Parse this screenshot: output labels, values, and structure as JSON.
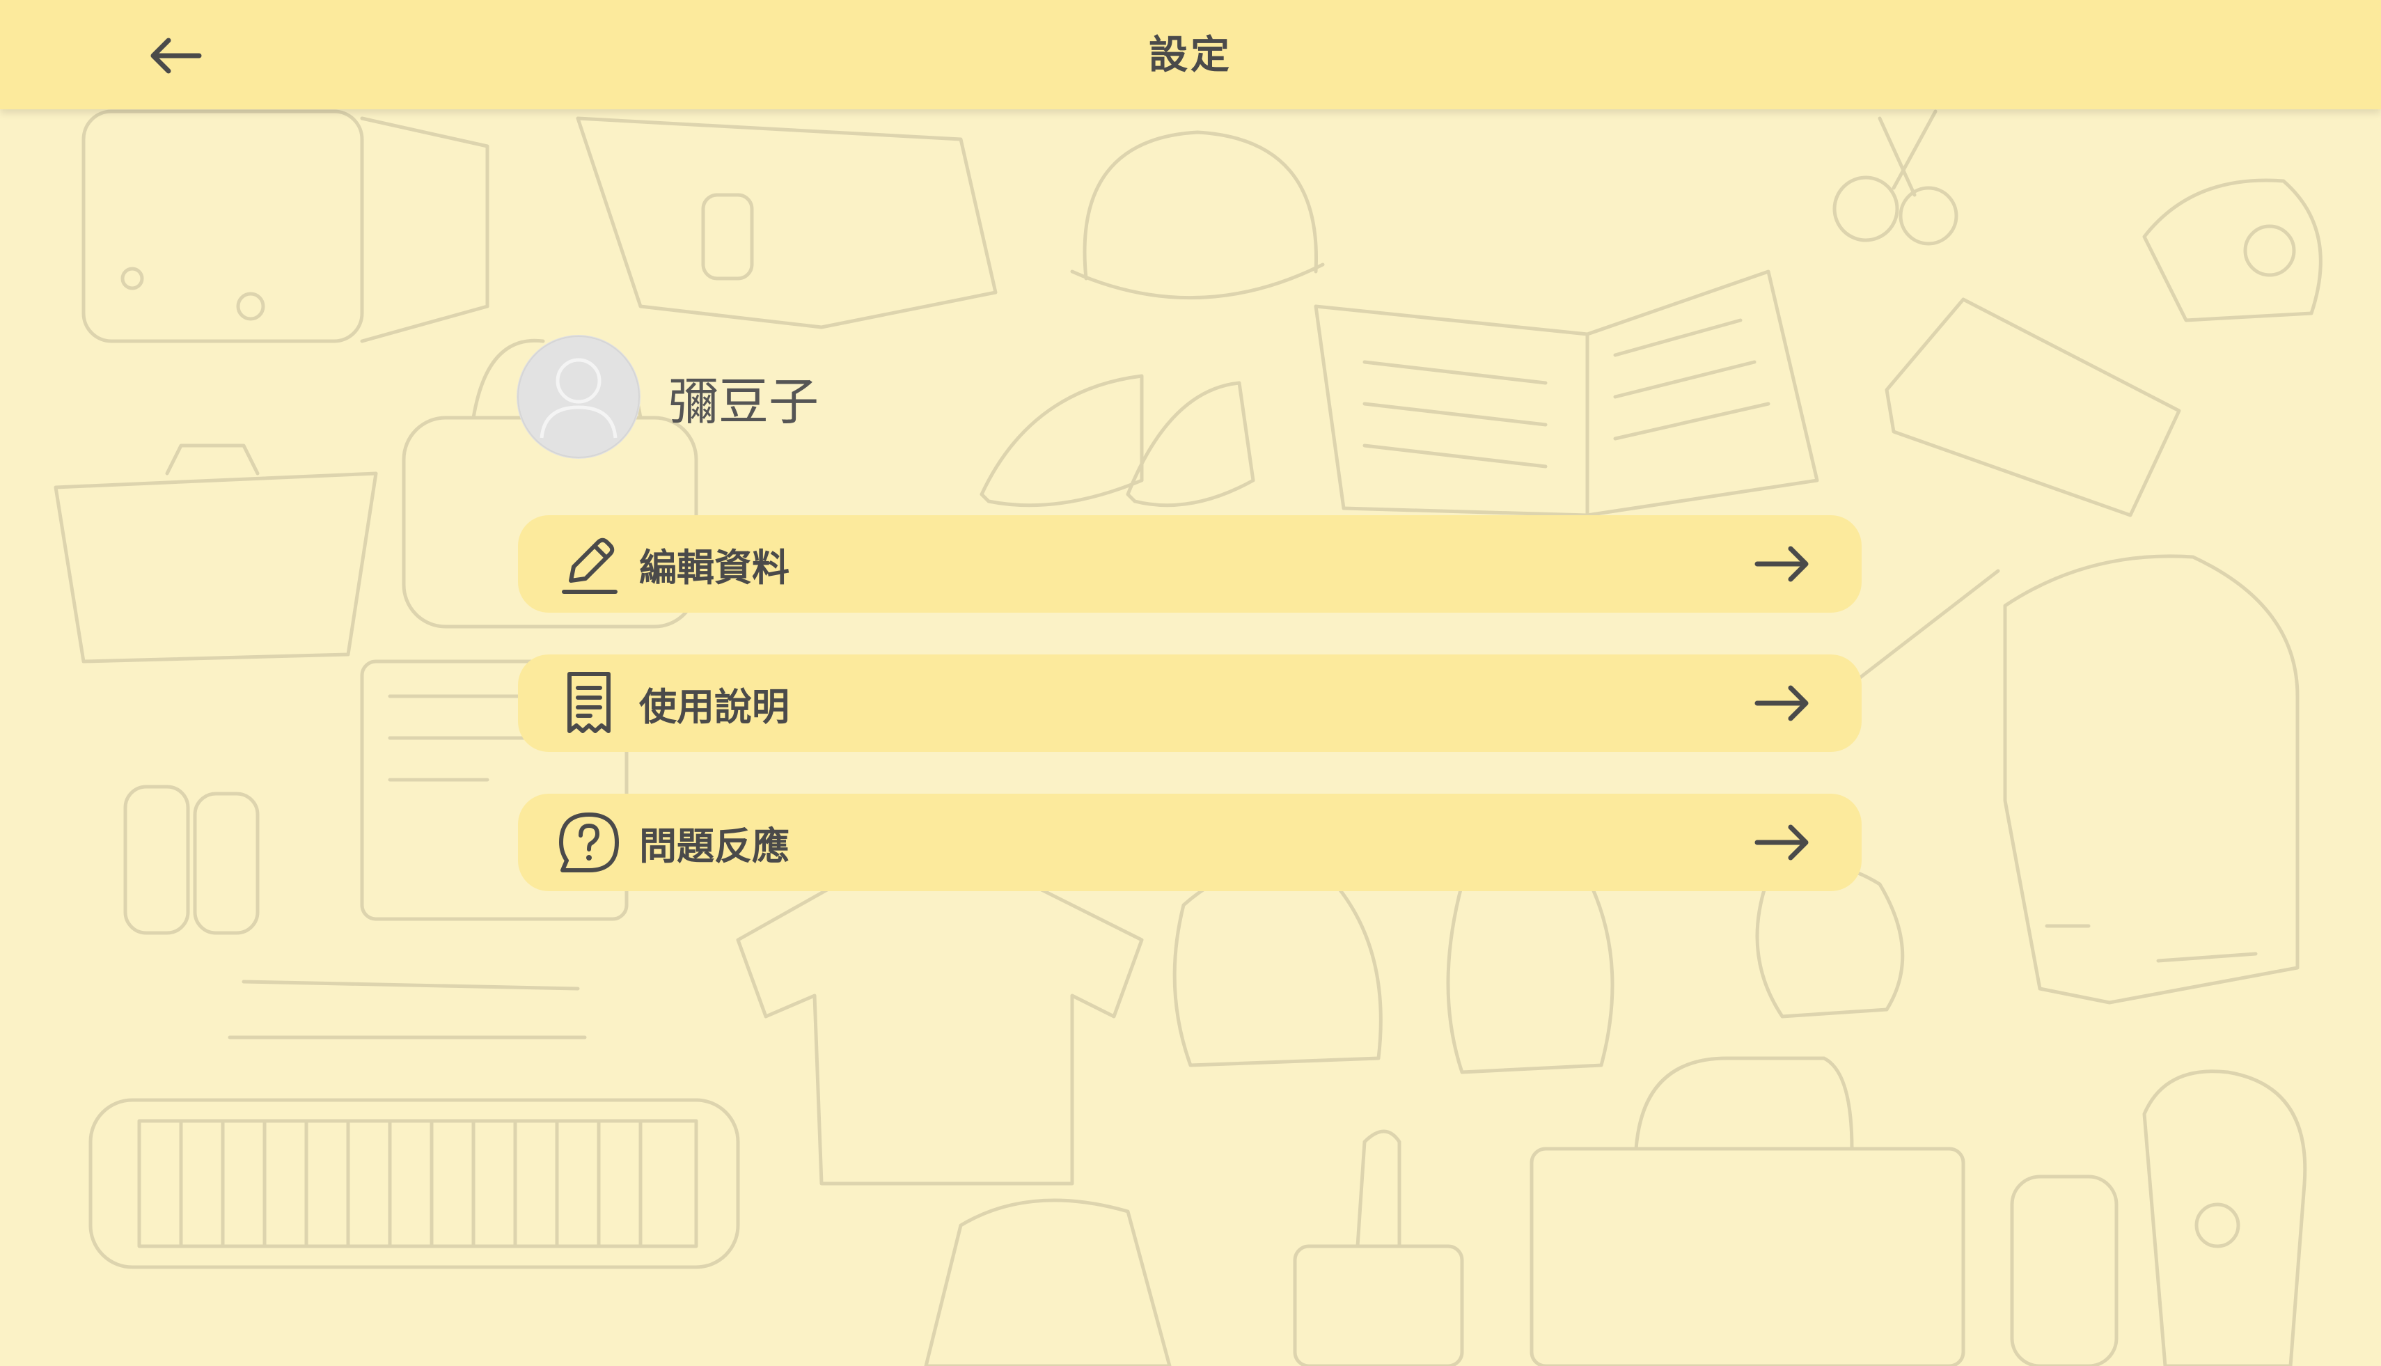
{
  "header": {
    "title": "設定",
    "back_icon": "arrow-left-icon"
  },
  "profile": {
    "name": "彌豆子",
    "avatar_icon": "user-avatar-icon"
  },
  "menu": [
    {
      "label": "編輯資料",
      "icon": "pencil-icon",
      "trailing_icon": "arrow-right-icon"
    },
    {
      "label": "使用說明",
      "icon": "receipt-document-icon",
      "trailing_icon": "arrow-right-icon"
    },
    {
      "label": "問題反應",
      "icon": "question-bubble-icon",
      "trailing_icon": "arrow-right-icon"
    }
  ],
  "colors": {
    "header_bg": "#FCEA9C",
    "page_bg": "#FBF2C6",
    "menu_bg": "#FCEA9C",
    "text": "#4A4A4A",
    "avatar_bg": "#E2E2E2"
  }
}
